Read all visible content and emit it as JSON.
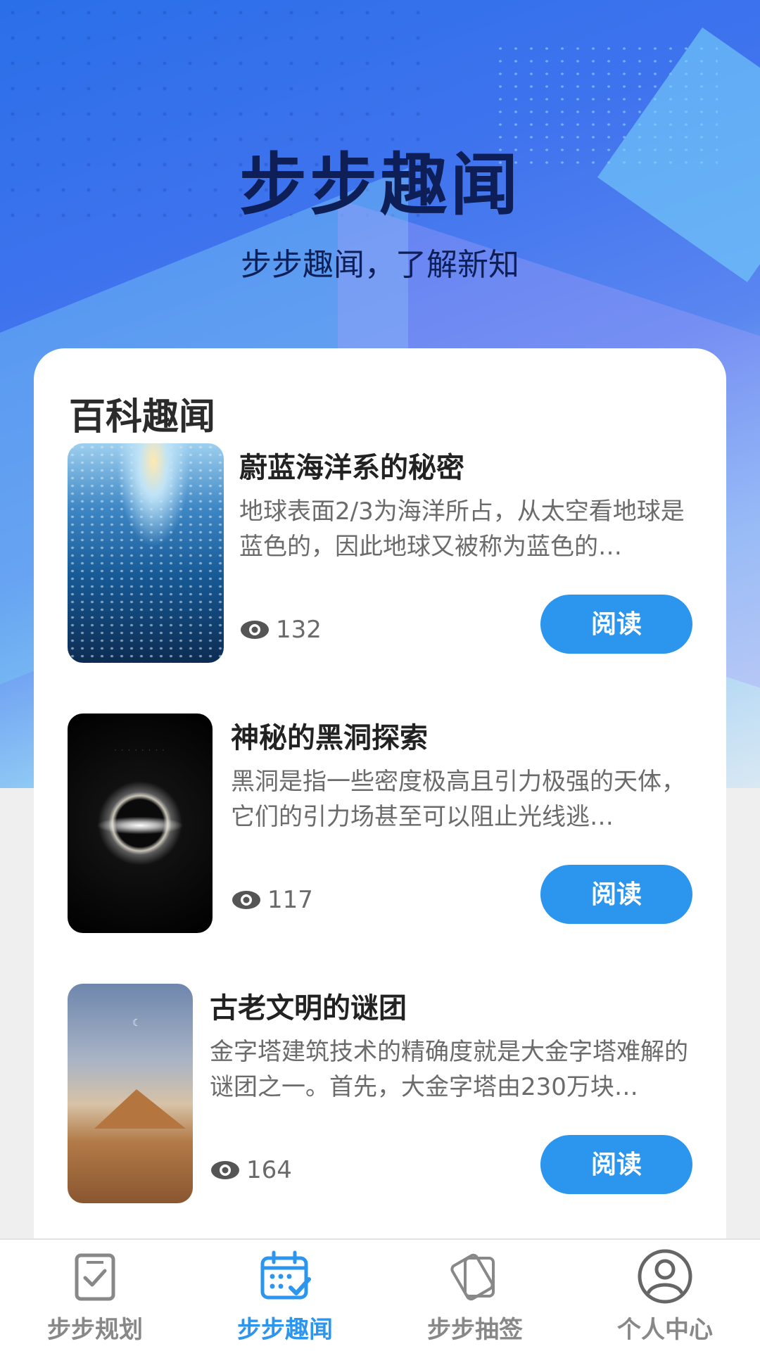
{
  "header": {
    "title": "步步趣闻",
    "subtitle": "步步趣闻，了解新知"
  },
  "section": {
    "title": "百科趣闻"
  },
  "articles": [
    {
      "title": "蔚蓝海洋系的秘密",
      "desc": "地球表面2/3为海洋所占，从太空看地球是蓝色的，因此地球又被称为蓝色的…",
      "views": "132",
      "button": "阅读",
      "image": "ocean-fish-image"
    },
    {
      "title": "神秘的黑洞探索",
      "desc": "黑洞是指一些密度极高且引力极强的天体，它们的引力场甚至可以阻止光线逃…",
      "views": "117",
      "button": "阅读",
      "image": "black-hole-image"
    },
    {
      "title": "古老文明的谜团",
      "desc": "金字塔建筑技术的精确度就是大金字塔难解的谜团之一。首先，大金字塔由230万块…",
      "views": "164",
      "button": "阅读",
      "image": "pyramid-desert-image"
    }
  ],
  "tabbar": {
    "items": [
      {
        "label": "步步规划",
        "icon": "checklist-icon",
        "active": false
      },
      {
        "label": "步步趣闻",
        "icon": "calendar-check-icon",
        "active": true
      },
      {
        "label": "步步抽签",
        "icon": "cards-icon",
        "active": false
      },
      {
        "label": "个人中心",
        "icon": "user-icon",
        "active": false
      }
    ]
  },
  "colors": {
    "accent": "#2c96ef",
    "title": "#0e1f57",
    "inactive": "#888888"
  }
}
